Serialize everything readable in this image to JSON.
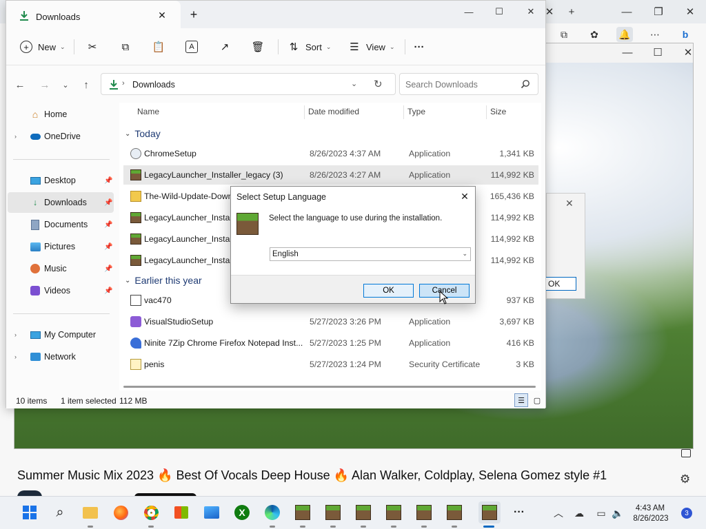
{
  "explorer": {
    "tab_title": "Downloads",
    "toolbar": {
      "new_label": "New",
      "sort_label": "Sort",
      "view_label": "View"
    },
    "address": "Downloads",
    "search_placeholder": "Search Downloads",
    "nav": [
      {
        "label": "Home",
        "icon": "home-icon"
      },
      {
        "label": "OneDrive",
        "icon": "onedrive-icon"
      },
      {
        "label": "Desktop",
        "icon": "desktop-icon"
      },
      {
        "label": "Downloads",
        "icon": "downloads-icon"
      },
      {
        "label": "Documents",
        "icon": "documents-icon"
      },
      {
        "label": "Pictures",
        "icon": "pictures-icon"
      },
      {
        "label": "Music",
        "icon": "music-icon"
      },
      {
        "label": "Videos",
        "icon": "videos-icon"
      },
      {
        "label": "My Computer",
        "icon": "computer-icon"
      },
      {
        "label": "Network",
        "icon": "network-icon"
      }
    ],
    "columns": {
      "name": "Name",
      "date": "Date modified",
      "type": "Type",
      "size": "Size"
    },
    "groups": {
      "today": "Today",
      "earlier": "Earlier this year"
    },
    "files": [
      {
        "name": "ChromeSetup",
        "date": "8/26/2023 4:37 AM",
        "type": "Application",
        "size": "1,341 KB"
      },
      {
        "name": "LegacyLauncher_Installer_legacy (3)",
        "date": "8/26/2023 4:27 AM",
        "type": "Application",
        "size": "114,992 KB"
      },
      {
        "name": "The-Wild-Update-Down",
        "date": "",
        "type": "",
        "size": "165,436 KB"
      },
      {
        "name": "LegacyLauncher_Installe",
        "date": "",
        "type": "",
        "size": "114,992 KB"
      },
      {
        "name": "LegacyLauncher_Installe",
        "date": "",
        "type": "",
        "size": "114,992 KB"
      },
      {
        "name": "LegacyLauncher_Installe",
        "date": "",
        "type": "",
        "size": "114,992 KB"
      },
      {
        "name": "vac470",
        "date": "",
        "type": "",
        "size": "937 KB"
      },
      {
        "name": "VisualStudioSetup",
        "date": "5/27/2023 3:26 PM",
        "type": "Application",
        "size": "3,697 KB"
      },
      {
        "name": "Ninite 7Zip Chrome Firefox Notepad Inst...",
        "date": "5/27/2023 1:25 PM",
        "type": "Application",
        "size": "416 KB"
      },
      {
        "name": "penis",
        "date": "5/27/2023 1:24 PM",
        "type": "Security Certificate",
        "size": "3 KB"
      }
    ],
    "status": {
      "count": "10 items",
      "selected": "1 item selected",
      "size": "112 MB"
    }
  },
  "dialog": {
    "title": "Select Setup Language",
    "message": "Select the language to use during the installation.",
    "language": "English",
    "ok_label": "OK",
    "cancel_label": "Cancel"
  },
  "background": {
    "behind_ok_label": "OK",
    "video_title": "Summer Music Mix 2023 🔥 Best Of Vocals Deep House 🔥 Alan Walker, Coldplay, Selena Gomez style #1"
  },
  "taskbar": {
    "time": "4:43 AM",
    "date": "8/26/2023",
    "notification_count": "3"
  }
}
